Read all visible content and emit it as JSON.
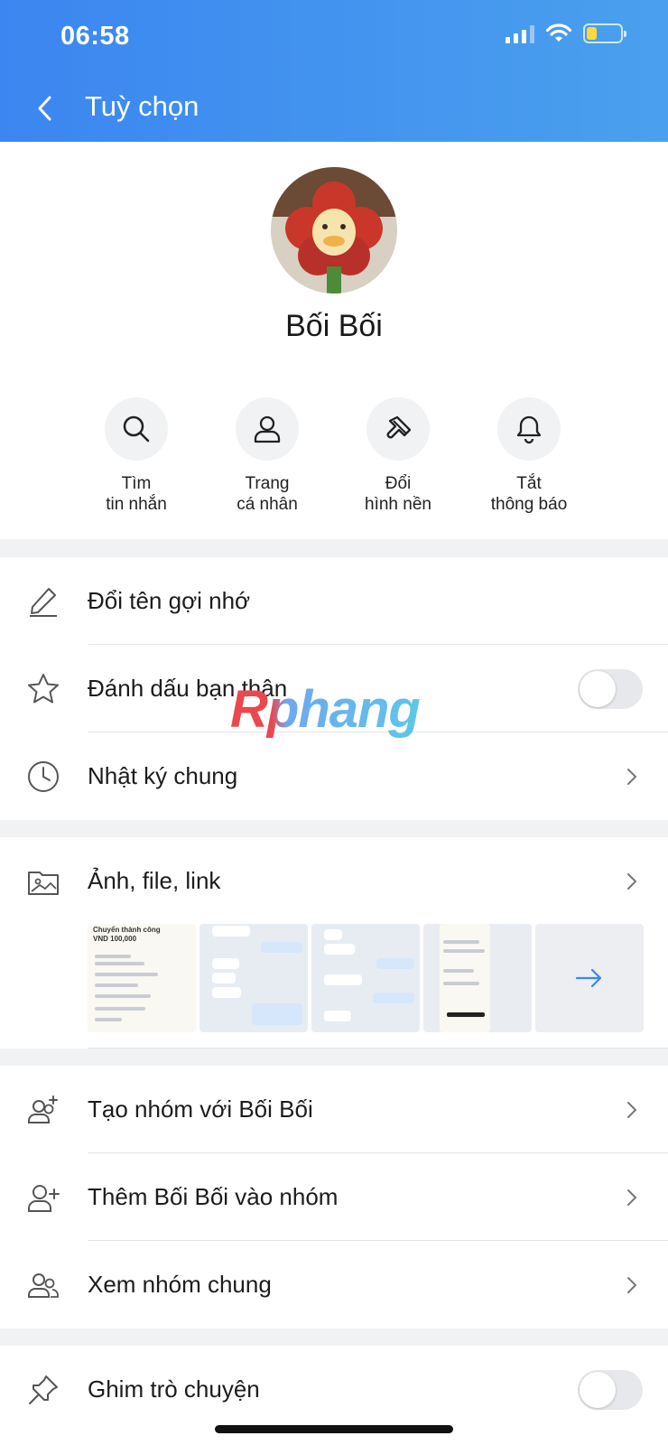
{
  "status_bar": {
    "time": "06:58",
    "battery_color": "#ffd93b",
    "battery_level": 0.3
  },
  "header": {
    "title": "Tuỳ chọn",
    "back_icon": "chevron-left-icon"
  },
  "profile": {
    "name": "Bối Bối",
    "avatar": "plush-flower-duck-photo",
    "actions": [
      {
        "icon": "search-icon",
        "line1": "Tìm",
        "line2": "tin nhắn"
      },
      {
        "icon": "person-icon",
        "line1": "Trang",
        "line2": "cá nhân"
      },
      {
        "icon": "paint-brush-icon",
        "line1": "Đổi",
        "line2": "hình nền"
      },
      {
        "icon": "bell-icon",
        "line1": "Tắt",
        "line2": "thông báo"
      }
    ]
  },
  "settings": {
    "rename": {
      "label": "Đổi tên gợi nhớ",
      "icon": "pencil-icon"
    },
    "best_friend": {
      "label": "Đánh dấu bạn thân",
      "icon": "star-icon",
      "on": false
    },
    "shared_journal": {
      "label": "Nhật ký chung",
      "icon": "clock-icon"
    }
  },
  "media": {
    "label": "Ảnh, file, link",
    "icon": "photo-folder-icon",
    "thumbnails": [
      {
        "kind": "transfer-receipt",
        "title": "Chuyển thành công",
        "amount": "VND 100,000"
      },
      {
        "kind": "chat-screenshot"
      },
      {
        "kind": "chat-screenshot"
      },
      {
        "kind": "transfer-receipt-phone"
      }
    ],
    "more_icon": "arrow-right-icon"
  },
  "groups": {
    "create": {
      "label": "Tạo nhóm với Bối Bối",
      "icon": "group-add-icon"
    },
    "add_to": {
      "label": "Thêm Bối Bối vào nhóm",
      "icon": "person-add-icon"
    },
    "common": {
      "label": "Xem nhóm chung",
      "icon": "group-icon"
    }
  },
  "pin": {
    "label": "Ghim trò chuyện",
    "icon": "pin-icon",
    "on": false
  },
  "watermark": {
    "text": "Rphang"
  },
  "colors": {
    "header_start": "#3b86f0",
    "header_end": "#4aa0ee",
    "accent": "#3b86f0",
    "toggle_off": "#e7e8eb"
  }
}
